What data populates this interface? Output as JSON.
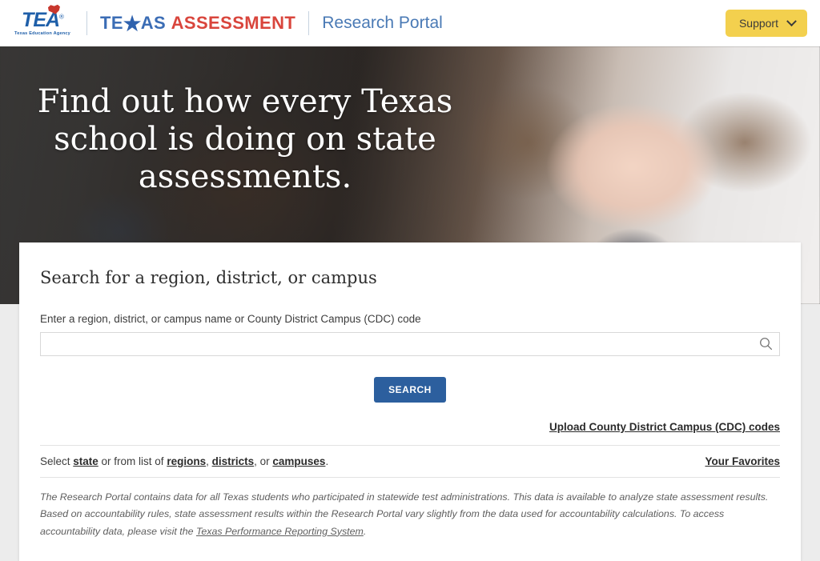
{
  "header": {
    "logo": {
      "mark": "TEA",
      "registered": "®",
      "subtitle": "Texas Education Agency",
      "icon": "texas-flag-shape"
    },
    "wordmark": {
      "part1": "TE",
      "star": "★",
      "part2": "AS",
      "part3": "ASSESSMENT",
      "blue": "#3b6db5",
      "red": "#d9453c"
    },
    "portal_title": "Research Portal",
    "support": {
      "label": "Support",
      "icon": "chevron-down-icon",
      "background": "#f3d04e"
    }
  },
  "hero": {
    "heading": "Find out how every Texas school is doing on state assessments.",
    "image_alt": "smiling-student-portrait"
  },
  "search_card": {
    "title": "Search for a region, district, or campus",
    "field_label": "Enter a region, district, or campus name or County District Campus (CDC) code",
    "input_value": "",
    "input_placeholder": "",
    "search_icon": "search-icon",
    "search_button": "SEARCH",
    "search_button_color": "#2c5f9e",
    "upload_link": "Upload County District Campus (CDC) codes",
    "select_row": {
      "prefix": "Select ",
      "link_state": "state",
      "middle": " or from list of ",
      "link_regions": "regions",
      "sep1": ", ",
      "link_districts": "districts",
      "sep2": ", or ",
      "link_campuses": "campuses",
      "suffix": ".",
      "favorites_link": "Your Favorites"
    },
    "disclaimer": {
      "text_part1": "The Research Portal contains data for all Texas students who participated in statewide test administrations. This data is available to analyze state assessment results. Based on accountability rules, state assessment results within the Research Portal vary slightly from the data used for accountability calculations. To access accountability data, please visit the ",
      "link": "Texas Performance Reporting System",
      "text_part2": "."
    }
  }
}
